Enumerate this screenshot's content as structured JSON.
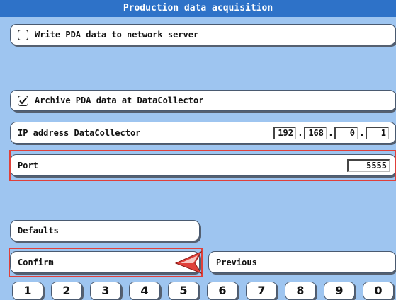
{
  "title": "Production data acquisition",
  "options": {
    "write_pda": {
      "label": "Write PDA data to network server",
      "checked": false
    },
    "archive_pda": {
      "label": "Archive PDA data at DataCollector",
      "checked": true
    }
  },
  "ip": {
    "label": "IP address DataCollector",
    "octets": [
      "192",
      "168",
      "0",
      "1"
    ]
  },
  "port": {
    "label": "Port",
    "value": "5555"
  },
  "buttons": {
    "defaults": "Defaults",
    "confirm": "Confirm",
    "previous": "Previous"
  },
  "keypad": [
    "1",
    "2",
    "3",
    "4",
    "5",
    "6",
    "7",
    "8",
    "9",
    "0"
  ],
  "colors": {
    "background": "#9ec5f0",
    "titlebar": "#2e72c8",
    "highlight": "#e0403a"
  }
}
